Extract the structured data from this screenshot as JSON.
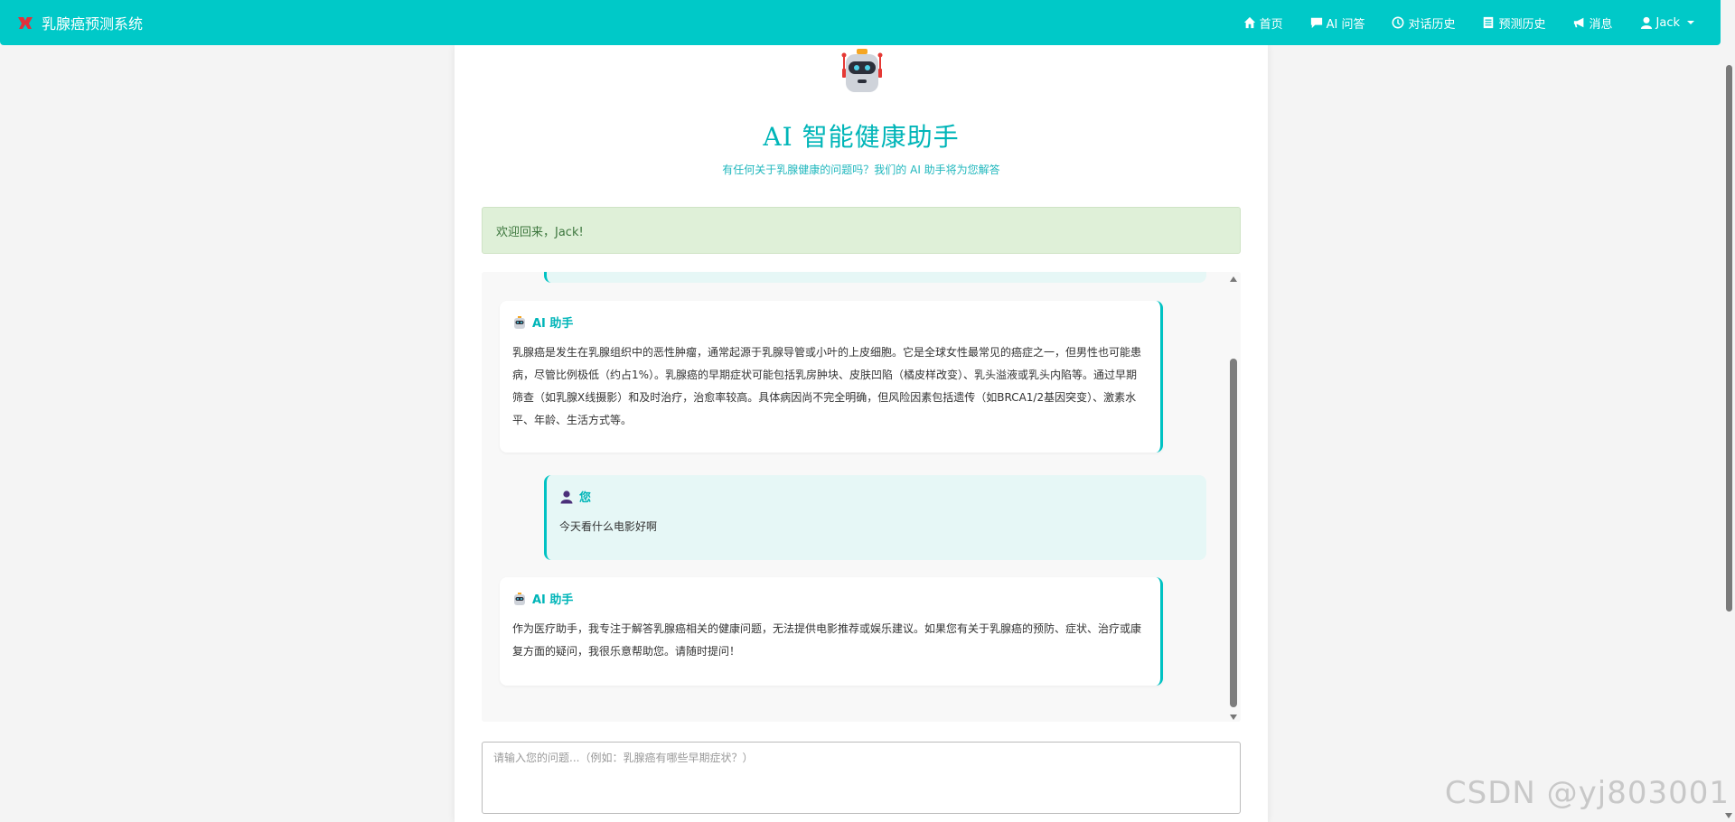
{
  "navbar": {
    "brand": "乳腺癌预测系统",
    "items": [
      {
        "label": "首页",
        "icon": "home-icon"
      },
      {
        "label": "AI 问答",
        "icon": "comment-icon"
      },
      {
        "label": "对话历史",
        "icon": "clock-icon"
      },
      {
        "label": "预测历史",
        "icon": "list-icon"
      },
      {
        "label": "消息",
        "icon": "bullhorn-icon"
      },
      {
        "label": "Jack",
        "icon": "user-icon"
      }
    ]
  },
  "header": {
    "title": "AI 智能健康助手",
    "subtitle": "有任何关于乳腺健康的问题吗？我们的 AI 助手将为您解答"
  },
  "alert": {
    "text": "欢迎回来，Jack!"
  },
  "chat": {
    "messages": [
      {
        "role": "ai",
        "sender": "AI 助手",
        "text": "乳腺癌是发生在乳腺组织中的恶性肿瘤，通常起源于乳腺导管或小叶的上皮细胞。它是全球女性最常见的癌症之一，但男性也可能患病，尽管比例极低（约占1%）。乳腺癌的早期症状可能包括乳房肿块、皮肤凹陷（橘皮样改变）、乳头溢液或乳头内陷等。通过早期筛查（如乳腺X线摄影）和及时治疗，治愈率较高。具体病因尚不完全明确，但风险因素包括遗传（如BRCA1/2基因突变）、激素水平、年龄、生活方式等。"
      },
      {
        "role": "user",
        "sender": "您",
        "text": "今天看什么电影好啊"
      },
      {
        "role": "ai",
        "sender": "AI 助手",
        "text": "作为医疗助手，我专注于解答乳腺癌相关的健康问题，无法提供电影推荐或娱乐建议。如果您有关于乳腺癌的预防、症状、治疗或康复方面的疑问，我很乐意帮助您。请随时提问！"
      }
    ]
  },
  "input": {
    "placeholder": "请输入您的问题...（例如：乳腺癌有哪些早期症状？）"
  },
  "watermark": "CSDN @yj803001",
  "colors": {
    "primary": "#00c9c8",
    "accent": "#00b5b8",
    "alert_bg": "#dff0d8",
    "user_bubble": "#e6f7f6"
  }
}
